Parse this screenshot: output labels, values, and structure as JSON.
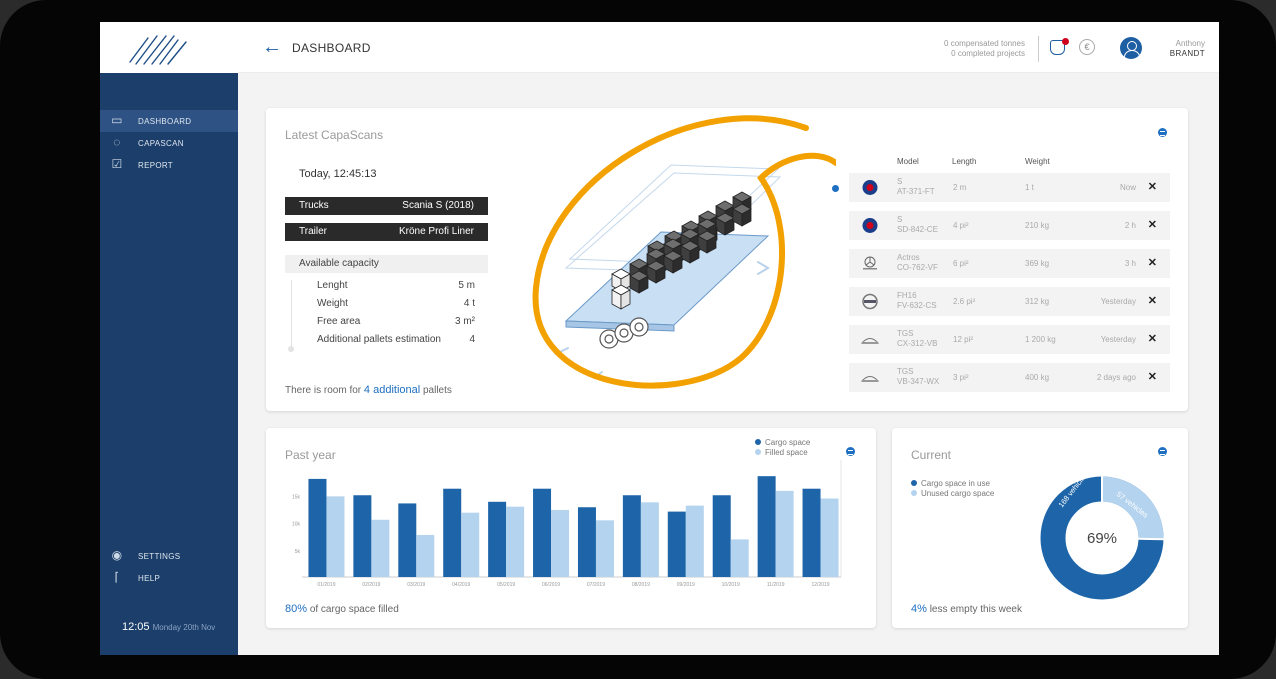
{
  "header": {
    "title": "DASHBOARD",
    "stats_line1": "0 compensated tonnes",
    "stats_line2": "0 completed projects",
    "user_first": "Anthony",
    "user_last": "BRANDT"
  },
  "sidebar": {
    "items": [
      {
        "label": "DASHBOARD",
        "icon": "monitor-icon",
        "active": true
      },
      {
        "label": "CAPASCAN",
        "icon": "scan-icon",
        "active": false
      },
      {
        "label": "REPORT",
        "icon": "report-icon",
        "active": false
      }
    ],
    "bottom_items": [
      {
        "label": "SETTINGS",
        "icon": "settings-icon"
      },
      {
        "label": "HELP",
        "icon": "help-icon"
      }
    ],
    "clock_time": "12:05",
    "clock_date": "Monday 20th Nov"
  },
  "scans": {
    "title": "Latest CapaScans",
    "time": "Today, 12:45:13",
    "trucks_label": "Trucks",
    "trucks_value": "Scania S (2018)",
    "trailer_label": "Trailer",
    "trailer_value": "Kröne Profi Liner",
    "capacity_title": "Available capacity",
    "capacity": [
      {
        "label": "Lenght",
        "value": "5 m"
      },
      {
        "label": "Weight",
        "value": "4 t"
      },
      {
        "label": "Free area",
        "value": "3 m²"
      },
      {
        "label": "Additional pallets estimation",
        "value": "4"
      }
    ],
    "room_prefix": "There is room for",
    "room_highlight": "4 additional",
    "room_suffix": "pallets",
    "columns": [
      "Model",
      "Length",
      "Weight"
    ],
    "rows": [
      {
        "brand": "scania",
        "model": "S",
        "plate": "AT-371-FT",
        "length": "2 m",
        "weight": "1 t",
        "time": "Now"
      },
      {
        "brand": "scania",
        "model": "S",
        "plate": "SD-842-CE",
        "length": "4 pi²",
        "weight": "210 kg",
        "time": "2 h"
      },
      {
        "brand": "mercedes",
        "model": "Actros",
        "plate": "CO-762-VF",
        "length": "6 pi²",
        "weight": "369 kg",
        "time": "3 h"
      },
      {
        "brand": "volvo",
        "model": "FH16",
        "plate": "FV-632-CS",
        "length": "2.6 pi²",
        "weight": "312 kg",
        "time": "Yesterday"
      },
      {
        "brand": "man",
        "model": "TGS",
        "plate": "CX-312-VB",
        "length": "12 pi²",
        "weight": "1 200 kg",
        "time": "Yesterday"
      },
      {
        "brand": "man",
        "model": "TGS",
        "plate": "VB-347-WX",
        "length": "3 pi²",
        "weight": "400 kg",
        "time": "2 days ago"
      }
    ]
  },
  "past_year": {
    "title": "Past year",
    "footer_highlight": "80%",
    "footer_text": "of cargo space filled"
  },
  "current": {
    "title": "Current",
    "legend_used": "Cargo space in use",
    "legend_unused": "Unused cargo space",
    "used_label": "168 vehicles",
    "unused_label": "57 vehicles",
    "center": "69%",
    "footer_highlight": "4%",
    "footer_text": "less empty this week"
  },
  "colors": {
    "accent": "#1e6fc1",
    "dark_blue": "#1d65a8",
    "light_blue": "#b4d3ee",
    "sidebar": "#1b3e6a",
    "highlight_orange": "#f2a100"
  },
  "chart_data": [
    {
      "type": "bar",
      "categories": [
        "01/2019",
        "02/2019",
        "03/2019",
        "04/2019",
        "05/2019",
        "06/2019",
        "07/2019",
        "08/2019",
        "09/2019",
        "10/2019",
        "11/2019",
        "12/2019"
      ],
      "series": [
        {
          "name": "Cargo space",
          "values": [
            18000,
            15000,
            13500,
            16200,
            13800,
            16200,
            12800,
            15000,
            12000,
            15000,
            18500,
            16200
          ]
        },
        {
          "name": "Filled space",
          "values": [
            14800,
            10500,
            7700,
            11800,
            12900,
            12300,
            10400,
            13700,
            13100,
            6900,
            15800,
            14400
          ]
        }
      ],
      "yticks": [
        "5k",
        "10k",
        "15k"
      ],
      "ylim": [
        0,
        20000
      ],
      "legend": "top-right"
    },
    {
      "type": "pie",
      "labels": [
        "Cargo space in use",
        "Unused cargo space"
      ],
      "values": [
        168,
        57
      ],
      "center_text": "69%"
    }
  ]
}
